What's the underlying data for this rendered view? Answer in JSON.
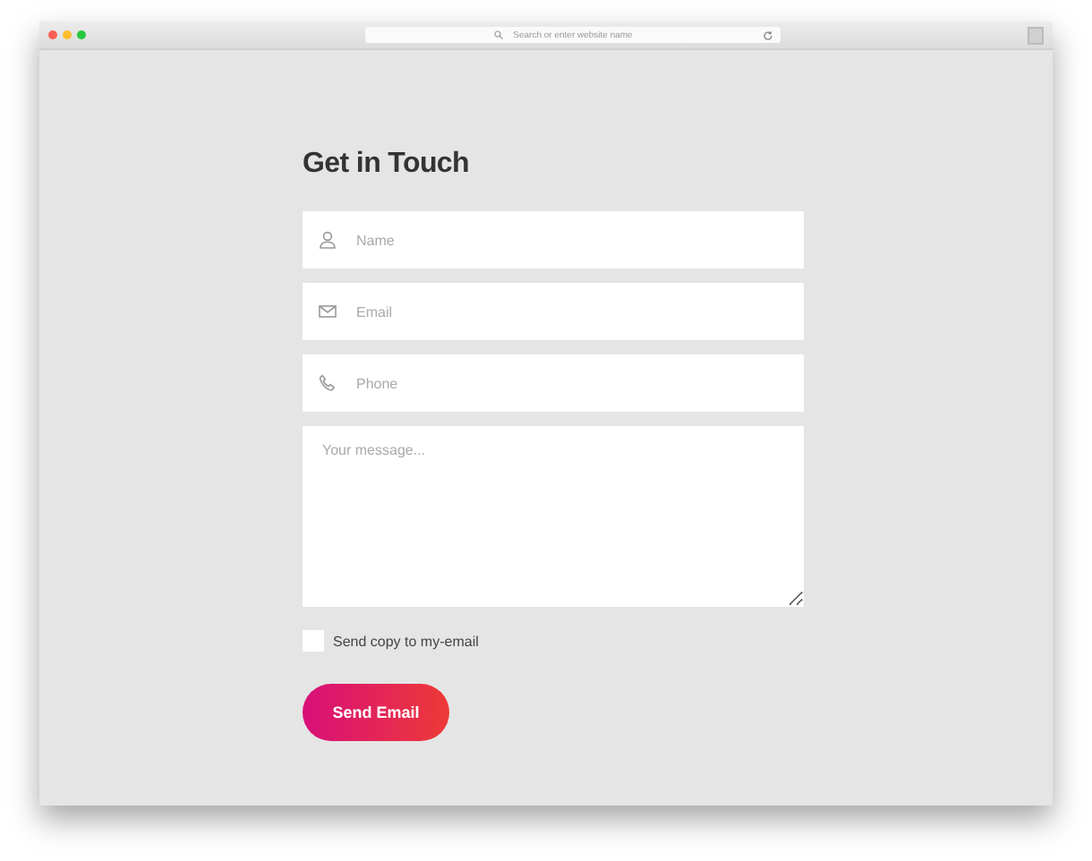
{
  "browser": {
    "address_placeholder": "Search or enter website name"
  },
  "form": {
    "title": "Get in Touch",
    "fields": [
      {
        "kind": "name",
        "placeholder": "Name"
      },
      {
        "kind": "email",
        "placeholder": "Email"
      },
      {
        "kind": "phone",
        "placeholder": "Phone"
      }
    ],
    "message": {
      "placeholder": "Your message..."
    },
    "copy_checkbox": {
      "label": "Send copy to my-email",
      "checked": false
    },
    "submit": "Send Email"
  }
}
